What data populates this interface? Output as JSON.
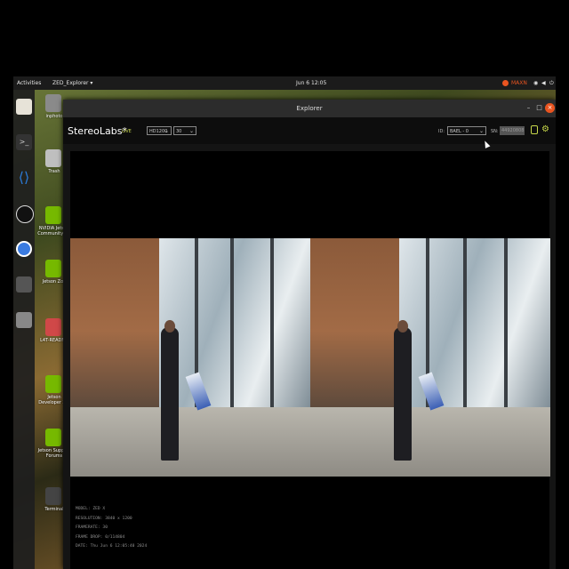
{
  "topbar": {
    "activities": "Activities",
    "app_menu": "ZED_Explorer ▾",
    "datetime": "Jun 6  12:05",
    "power_mode": "MAXN"
  },
  "desktop": {
    "icons": [
      {
        "label": "inphoto",
        "color": "#8a8a8a"
      },
      {
        "label": "Trash",
        "color": "#bfbfbf"
      },
      {
        "label": "NVIDIA Jetson Community P...",
        "color": "#76b900"
      },
      {
        "label": "Jetson Zoo",
        "color": "#76b900"
      },
      {
        "label": "L4T-README",
        "color": "#d04848"
      },
      {
        "label": "Jetson Developer Z...",
        "color": "#76b900"
      },
      {
        "label": "Jetson Support Forums",
        "color": "#76b900"
      },
      {
        "label": "Terminal",
        "color": "#444"
      }
    ]
  },
  "dock": {
    "items": [
      {
        "name": "files-icon",
        "color": "#e7e3d8"
      },
      {
        "name": "terminal-icon",
        "color": "#333"
      },
      {
        "name": "vscode-icon",
        "color": "#2b7bd8"
      },
      {
        "name": "obs-icon",
        "color": "#222"
      },
      {
        "name": "chromium-icon",
        "color": "#3a7be0"
      },
      {
        "name": "app-icon",
        "color": "#555"
      },
      {
        "name": "drive-icon",
        "color": "#888"
      }
    ]
  },
  "window": {
    "title": "Explorer",
    "minimize": "–",
    "maximize": "□",
    "close": "×"
  },
  "toolbar": {
    "brand": "StereoLabs*",
    "live": "LIVE",
    "resolution": "HD1200",
    "fps": "30",
    "id_label": "ID:",
    "id_value": "BAEL - 0",
    "sn_label": "SN:",
    "sn_value": "44920808"
  },
  "info": {
    "model": "MODEL: ZED X",
    "resolution": "RESOLUTION: 3840 x 1200",
    "framerate": "FRAMERATE: 30",
    "frame_drop": "FRAME DROP: 0/114804",
    "date": "DATE: Thu Jun 6 12:05:40 2024"
  },
  "colors": {
    "accent_live": "#c8d84a",
    "close_button": "#e95420"
  }
}
